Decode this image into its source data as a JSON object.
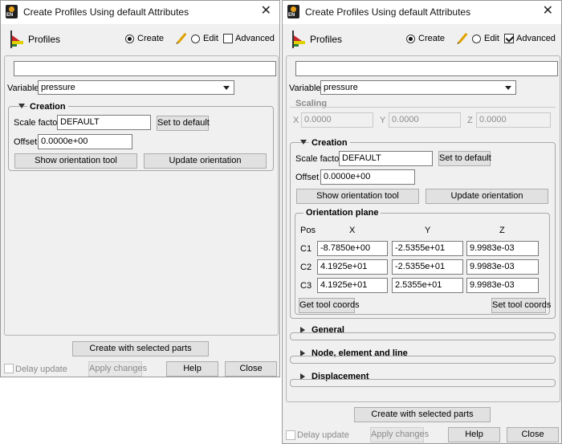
{
  "left": {
    "title": "Create Profiles Using default Attributes",
    "header": {
      "label": "Profiles",
      "create": "Create",
      "edit": "Edit",
      "advanced": "Advanced",
      "advanced_checked": false
    },
    "variable_label": "Variable",
    "variable_value": "pressure",
    "creation": {
      "title": "Creation",
      "scale_label": "Scale factor",
      "scale_value": "DEFAULT",
      "set_default": "Set to default",
      "offset_label": "Offset",
      "offset_value": "0.0000e+00",
      "show_tool": "Show orientation tool",
      "update_orient": "Update orientation"
    },
    "create_parts": "Create with selected parts",
    "delay_update": "Delay update",
    "apply": "Apply changes",
    "help": "Help",
    "close": "Close"
  },
  "right": {
    "title": "Create Profiles Using default Attributes",
    "header": {
      "label": "Profiles",
      "create": "Create",
      "edit": "Edit",
      "advanced": "Advanced",
      "advanced_checked": true
    },
    "variable_label": "Variable",
    "variable_value": "pressure",
    "scaling": {
      "title": "Scaling",
      "x_label": "X",
      "x_value": "0.0000",
      "y_label": "Y",
      "y_value": "0.0000",
      "z_label": "Z",
      "z_value": "0.0000"
    },
    "creation": {
      "title": "Creation",
      "scale_label": "Scale factor",
      "scale_value": "DEFAULT",
      "set_default": "Set to default",
      "offset_label": "Offset",
      "offset_value": "0.0000e+00",
      "show_tool": "Show orientation tool",
      "update_orient": "Update orientation"
    },
    "orientation": {
      "title": "Orientation plane",
      "headers": [
        "Pos",
        "X",
        "Y",
        "Z"
      ],
      "rows": [
        {
          "label": "C1",
          "x": "-8.7850e+00",
          "y": "-2.5355e+01",
          "z": "9.9983e-03"
        },
        {
          "label": "C2",
          "x": "4.1925e+01",
          "y": "-2.5355e+01",
          "z": "9.9983e-03"
        },
        {
          "label": "C3",
          "x": "4.1925e+01",
          "y": "2.5355e+01",
          "z": "9.9983e-03"
        }
      ],
      "get_coords": "Get tool coords",
      "set_coords": "Set tool coords"
    },
    "sections": [
      "General",
      "Node, element and line",
      "Displacement"
    ],
    "create_parts": "Create with selected parts",
    "delay_update": "Delay update",
    "apply": "Apply changes",
    "help": "Help",
    "close": "Close"
  }
}
